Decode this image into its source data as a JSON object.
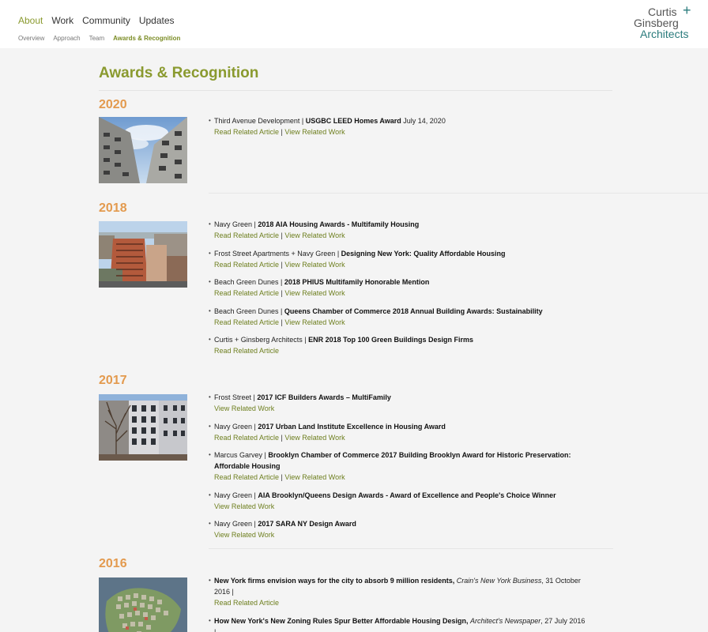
{
  "nav": {
    "main": [
      "About",
      "Work",
      "Community",
      "Updates"
    ],
    "sub": [
      "Overview",
      "Approach",
      "Team",
      "Awards & Recognition"
    ]
  },
  "logo": {
    "line1": "Curtis",
    "plus": "+",
    "line2": "Ginsberg",
    "line3": "Architects"
  },
  "page_title": "Awards & Recognition",
  "links": {
    "article": "Read Related Article",
    "work": "View Related Work",
    "separator": "|"
  },
  "sections": {
    "y2020": {
      "year": "2020",
      "items": [
        {
          "project": "Third Avenue Development | ",
          "title": "USGBC LEED Homes Award",
          "date": " July 14, 2020"
        }
      ]
    },
    "y2018": {
      "year": "2018",
      "items": [
        {
          "project": "Navy Green | ",
          "title": "2018 AIA Housing Awards - Multifamily Housing"
        },
        {
          "project": "Frost Street Apartments + Navy Green | ",
          "title": "Designing New York: Quality Affordable Housing"
        },
        {
          "project": "Beach Green Dunes | ",
          "title": "2018 PHIUS Multifamily Honorable Mention"
        },
        {
          "project": "Beach Green Dunes | ",
          "title": "Queens Chamber of Commerce 2018 Annual Building Awards: Sustainability"
        },
        {
          "project": "Curtis + Ginsberg Architects | ",
          "title": "ENR 2018 Top 100 Green Buildings Design Firms"
        }
      ]
    },
    "y2017": {
      "year": "2017",
      "items": [
        {
          "project": "Frost Street | ",
          "title": "2017 ICF Builders Awards – MultiFamily"
        },
        {
          "project": "Navy Green | ",
          "title": "2017 Urban Land Institute Excellence in Housing Award"
        },
        {
          "project": "Marcus Garvey | ",
          "title": "Brooklyn Chamber of Commerce 2017 Building Brooklyn Award for Historic Preservation: Affordable Housing"
        },
        {
          "project": "Navy Green | ",
          "title": "AIA Brooklyn/Queens Design Awards - Award of Excellence and People's Choice Winner"
        },
        {
          "project": "Navy Green | ",
          "title": "2017 SARA NY Design Award"
        }
      ]
    },
    "y2016": {
      "year": "2016",
      "items": [
        {
          "title": "New York firms envision ways for the city to absorb 9 million residents,",
          "pub": "Crain's New York Business",
          "date": ", 31 October 2016 |"
        },
        {
          "title": "How New York's New Zoning Rules Spur Better Affordable Housing Design,",
          "pub": "Architect's Newspaper",
          "date": ", 27 July 2016 |"
        }
      ]
    }
  },
  "colors": {
    "accent_green": "#8a9a2f",
    "link_green": "#6e7f1f",
    "year_orange": "#e39a4e",
    "logo_teal": "#2a7b7c"
  }
}
